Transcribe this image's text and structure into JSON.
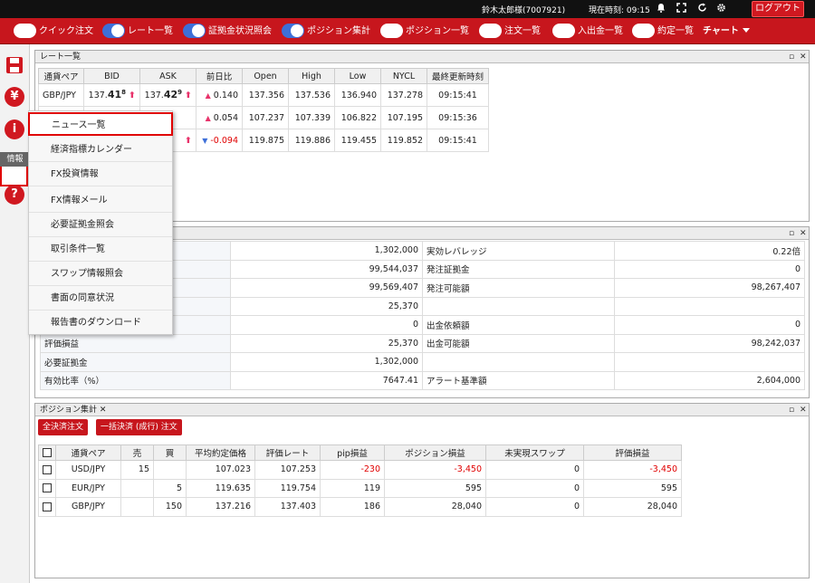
{
  "topbar": {
    "user": "鈴木太郎様(7007921)",
    "clock_label": "現在時刻: 09:15",
    "logout": "ログアウト",
    "icons": [
      "bell-icon",
      "fullscreen-icon",
      "refresh-icon",
      "gear-icon"
    ]
  },
  "toolbar": {
    "items": [
      {
        "label": "クイック注文",
        "on": false
      },
      {
        "label": "レート一覧",
        "on": true
      },
      {
        "label": "証拠金状況照会",
        "on": true
      },
      {
        "label": "ポジション集計",
        "on": true
      },
      {
        "label": "ポジション一覧",
        "on": false
      },
      {
        "label": "注文一覧",
        "on": false
      },
      {
        "label": "入出金一覧",
        "on": false
      },
      {
        "label": "約定一覧",
        "on": false
      }
    ],
    "chart": "チャート"
  },
  "sidebar": {
    "tooltip": "情報",
    "icons": [
      "save-icon",
      "yen-icon",
      "info-icon",
      "help-icon"
    ]
  },
  "rate_panel": {
    "title": "レート一覧",
    "headers": [
      "通貨ペア",
      "BID",
      "ASK",
      "前日比",
      "Open",
      "High",
      "Low",
      "NYCL",
      "最終更新時刻"
    ],
    "rows": [
      {
        "pair": "GBP/JPY",
        "bid_pre": "137.",
        "bid_big": "41",
        "bid_sup": "8",
        "ask_pre": "137.",
        "ask_big": "42",
        "ask_sup": "9",
        "change": "0.140",
        "dir": "up",
        "open": "137.356",
        "high": "137.536",
        "low": "136.940",
        "nycl": "137.278",
        "time": "09:15:41"
      },
      {
        "pair": "",
        "bid_pre": "",
        "bid_big": "",
        "bid_sup": "",
        "ask_pre": "",
        "ask_big": "",
        "ask_sup": "",
        "change": "0.054",
        "dir": "up",
        "open": "107.237",
        "high": "107.339",
        "low": "106.822",
        "nycl": "107.195",
        "time": "09:15:36"
      },
      {
        "pair": "",
        "bid_pre": "",
        "bid_big": "",
        "bid_sup": "",
        "ask_pre": "",
        "ask_big": "",
        "ask_sup": "",
        "change": "-0.094",
        "dir": "down",
        "open": "119.875",
        "high": "119.886",
        "low": "119.455",
        "nycl": "119.852",
        "time": "09:15:41"
      }
    ]
  },
  "margin_panel": {
    "rows": [
      {
        "l1": "",
        "v1": "1,302,000",
        "l2": "実効レバレッジ",
        "v2": "0.22倍"
      },
      {
        "l1": "",
        "v1": "99,544,037",
        "l2": "発注証拠金",
        "v2": "0"
      },
      {
        "l1": "",
        "v1": "99,569,407",
        "l2": "発注可能額",
        "v2": "98,267,407"
      },
      {
        "l1": "",
        "v1": "25,370",
        "l2": "",
        "v2": ""
      },
      {
        "l1": "",
        "v1": "0",
        "l2": "出金依頼額",
        "v2": "0"
      },
      {
        "l1": "評価損益",
        "v1": "25,370",
        "l2": "出金可能額",
        "v2": "98,242,037"
      },
      {
        "l1": "必要証拠金",
        "v1": "1,302,000",
        "l2": "",
        "v2": ""
      },
      {
        "l1": "有効比率（%）",
        "v1": "7647.41",
        "l2": "アラート基準額",
        "v2": "2,604,000"
      }
    ]
  },
  "position_panel": {
    "title": "ポジション集計",
    "btn_settle_all": "全決済注文",
    "btn_bulk": "一括決済 (成行) 注文",
    "headers": [
      "通貨ペア",
      "売",
      "買",
      "平均約定価格",
      "評価レート",
      "pip損益",
      "ポジション損益",
      "未実現スワップ",
      "評価損益"
    ],
    "rows": [
      {
        "pair": "USD/JPY",
        "sell": "15",
        "buy": "",
        "avg": "107.023",
        "rate": "107.253",
        "pip": "-230",
        "pl": "-3,450",
        "swap": "0",
        "eval": "-3,450"
      },
      {
        "pair": "EUR/JPY",
        "sell": "",
        "buy": "5",
        "avg": "119.635",
        "rate": "119.754",
        "pip": "119",
        "pl": "595",
        "swap": "0",
        "eval": "595"
      },
      {
        "pair": "GBP/JPY",
        "sell": "",
        "buy": "150",
        "avg": "137.216",
        "rate": "137.403",
        "pip": "186",
        "pl": "28,040",
        "swap": "0",
        "eval": "28,040"
      }
    ]
  },
  "info_menu": {
    "items": [
      "ニュース一覧",
      "経済指標カレンダー",
      "FX投資情報",
      "FX情報メール",
      "必要証拠金照会",
      "取引条件一覧",
      "スワップ情報照会",
      "書面の同意状況",
      "報告書のダウンロード"
    ]
  },
  "colors": {
    "brand_red": "#c7161d",
    "toggle_on": "#3d6fd8",
    "up": "#e8336b",
    "negative": "#e00000"
  }
}
